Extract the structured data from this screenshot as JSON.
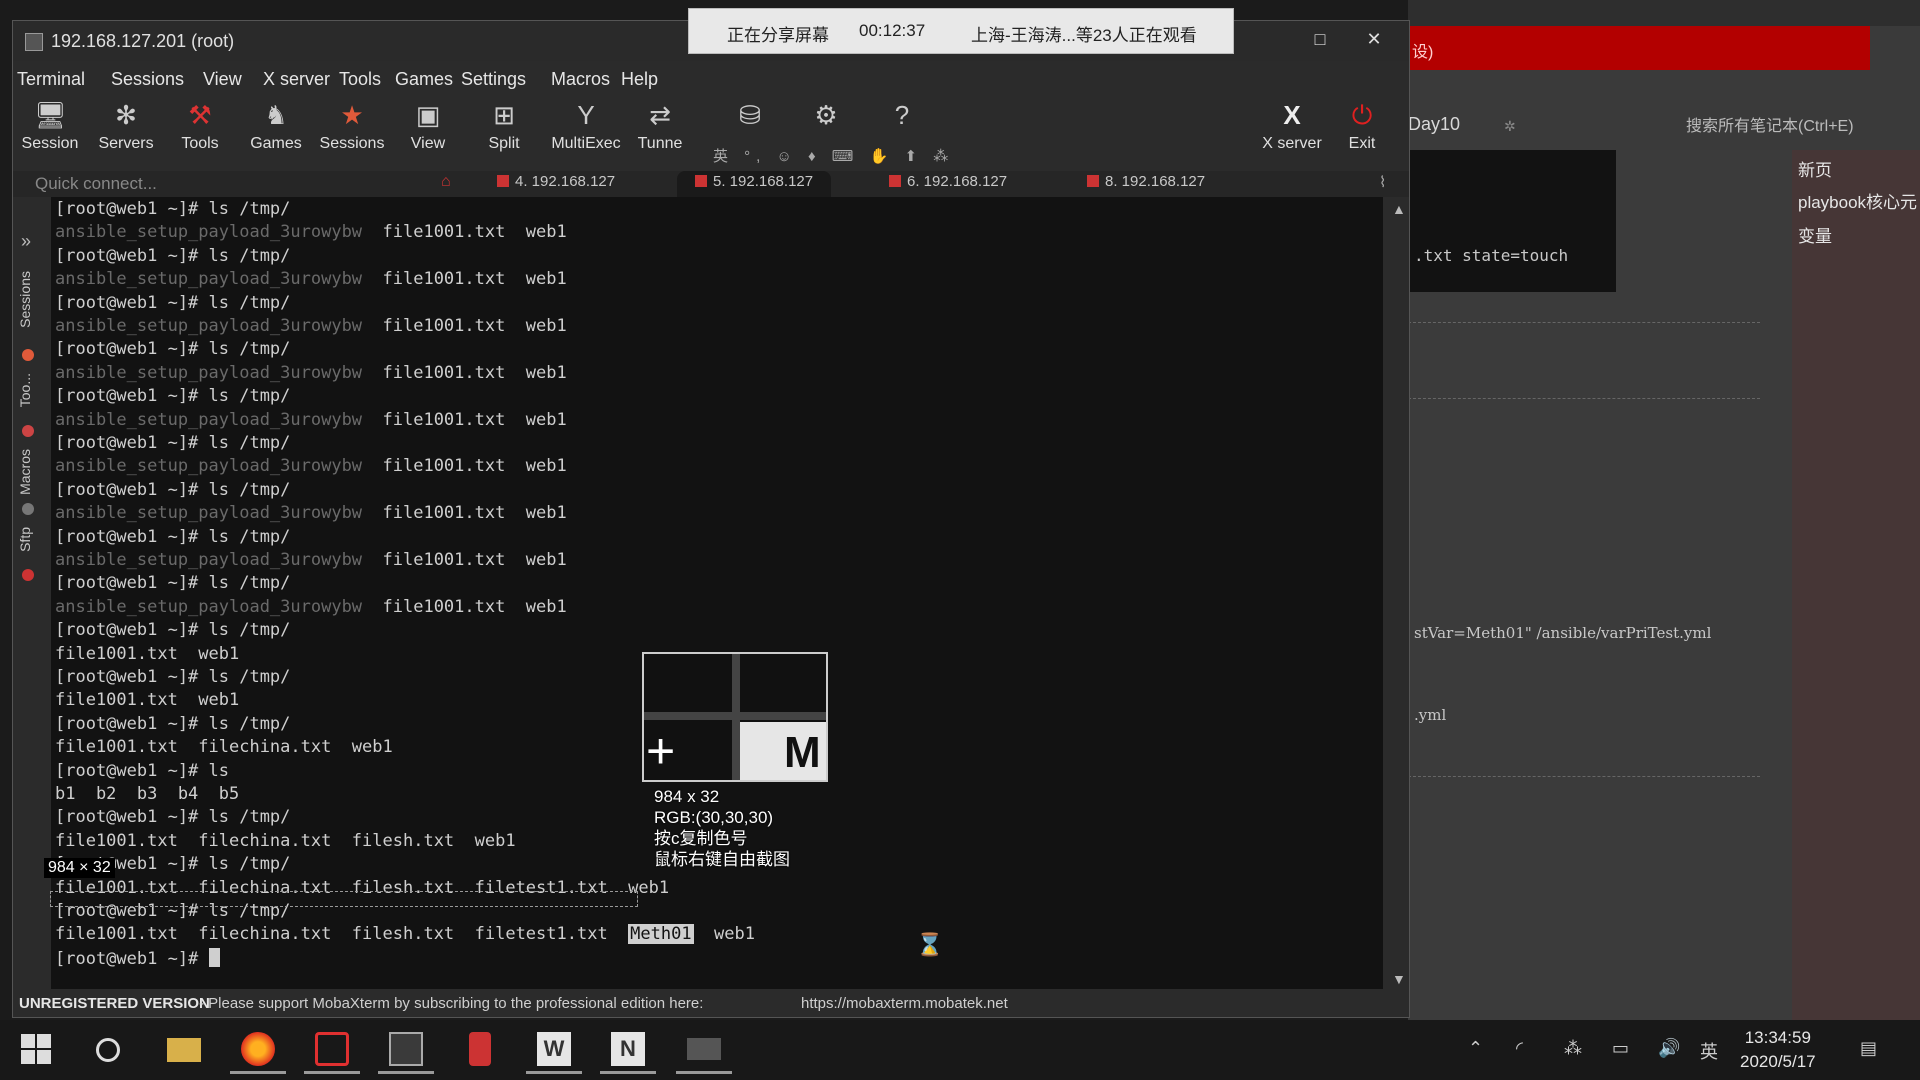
{
  "window": {
    "title": "192.168.127.201 (root)",
    "minimize": "—",
    "maximize": "□",
    "close": "✕"
  },
  "share_banner": {
    "status": "正在分享屏幕",
    "time": "00:12:37",
    "viewers": "上海-王海涛...等23人正在观看"
  },
  "menu": [
    "Terminal",
    "Sessions",
    "View",
    "X server",
    "Tools",
    "Games",
    "Settings",
    "Macros",
    "Help"
  ],
  "toolbar": {
    "session": "Session",
    "servers": "Servers",
    "tools": "Tools",
    "games": "Games",
    "sessions": "Sessions",
    "view": "View",
    "split": "Split",
    "multiexec": "MultiExec",
    "tunnel": "Tunne",
    "xserver": "X server",
    "exit": "Exit",
    "mini_icons": "英 °, ☺ ♦ ⌨ ✋ ⬆ ⁂"
  },
  "tabs": {
    "quick_connect_placeholder": "Quick connect...",
    "items": [
      "4. 192.168.127",
      "5. 192.168.127",
      "6. 192.168.127",
      "8. 192.168.127"
    ],
    "active_index": 1
  },
  "side_tabs": [
    "Sessions",
    "Too...",
    "Macros",
    "Sftp"
  ],
  "terminal": {
    "lines": [
      {
        "t": "[root@web1 ~]# ls /tmp/"
      },
      {
        "d": "ansible_setup_payload_3urowybw",
        "t": "  file1001.txt  web1"
      },
      {
        "t": "[root@web1 ~]# ls /tmp/"
      },
      {
        "d": "ansible_setup_payload_3urowybw",
        "t": "  file1001.txt  web1"
      },
      {
        "t": "[root@web1 ~]# ls /tmp/"
      },
      {
        "d": "ansible_setup_payload_3urowybw",
        "t": "  file1001.txt  web1"
      },
      {
        "t": "[root@web1 ~]# ls /tmp/"
      },
      {
        "d": "ansible_setup_payload_3urowybw",
        "t": "  file1001.txt  web1"
      },
      {
        "t": "[root@web1 ~]# ls /tmp/"
      },
      {
        "d": "ansible_setup_payload_3urowybw",
        "t": "  file1001.txt  web1"
      },
      {
        "t": "[root@web1 ~]# ls /tmp/"
      },
      {
        "d": "ansible_setup_payload_3urowybw",
        "t": "  file1001.txt  web1"
      },
      {
        "t": "[root@web1 ~]# ls /tmp/"
      },
      {
        "d": "ansible_setup_payload_3urowybw",
        "t": "  file1001.txt  web1"
      },
      {
        "t": "[root@web1 ~]# ls /tmp/"
      },
      {
        "d": "ansible_setup_payload_3urowybw",
        "t": "  file1001.txt  web1"
      },
      {
        "t": "[root@web1 ~]# ls /tmp/"
      },
      {
        "d": "ansible_setup_payload_3urowybw",
        "t": "  file1001.txt  web1"
      },
      {
        "t": "[root@web1 ~]# ls /tmp/"
      },
      {
        "t": "file1001.txt  web1"
      },
      {
        "t": "[root@web1 ~]# ls /tmp/"
      },
      {
        "t": "file1001.txt  web1"
      },
      {
        "t": "[root@web1 ~]# ls /tmp/"
      },
      {
        "t": "file1001.txt  filechina.txt  web1"
      },
      {
        "t": "[root@web1 ~]# ls"
      },
      {
        "t": "b1  b2  b3  b4  b5"
      },
      {
        "t": "[root@web1 ~]# ls /tmp/"
      },
      {
        "t": "file1001.txt  filechina.txt  filesh.txt  web1"
      },
      {
        "t": "[root@web1 ~]# ls /tmp/"
      },
      {
        "t": "file1001.txt  filechina.txt  filesh.txt  filetest1.txt  web1"
      },
      {
        "t": "[root@web1 ~]# ls /tmp/"
      }
    ],
    "last_output_prefix": "file1001.txt  filechina.txt  filesh.txt  filetest1.txt  ",
    "last_output_highlight": "Meth01",
    "last_output_suffix": "  web1",
    "prompt": "[root@web1 ~]# "
  },
  "statusbar": {
    "unregistered": "UNREGISTERED VERSION",
    "message": "-  Please support MobaXterm by subscribing to the professional edition here:",
    "link": "https://mobaxterm.mobatek.net"
  },
  "capture_overlay": {
    "selection_size": "984 × 32",
    "info_size": "984 x 32",
    "rgb": "RGB:(30,30,30)",
    "copy_hint": "按c复制色号",
    "rightclick_hint": "鼠标右键自由截图"
  },
  "background_app": {
    "note_title": "Day10",
    "search_placeholder": "搜索所有笔记本(Ctrl+E)",
    "code_snippet": ".txt state=touch",
    "doc_line_1": "stVar=Meth01\" /ansible/varPriTest.yml",
    "doc_line_2": ".yml",
    "sidebar_items": [
      "新页",
      "playbook核心元",
      "变量"
    ],
    "red_bar_text": "设)"
  },
  "taskbar": {
    "ime": "英",
    "time": "13:34:59",
    "date": "2020/5/17"
  },
  "colors": {
    "terminal_bg": "#121212",
    "dim_text": "#6a6a6a",
    "exit_red": "#e02020",
    "sessions_star": "#e05a3a"
  }
}
